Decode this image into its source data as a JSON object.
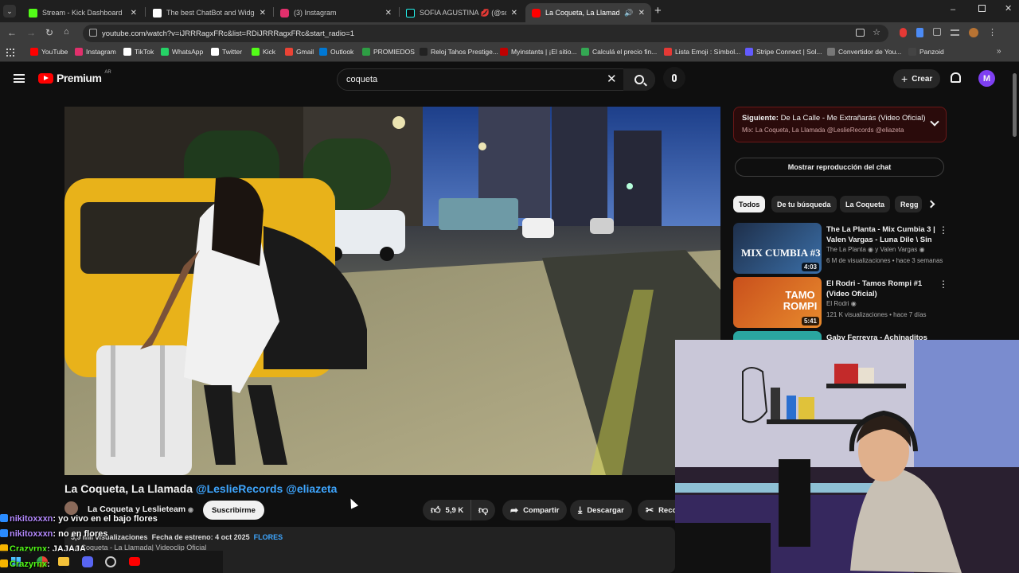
{
  "browser": {
    "tabs": [
      {
        "title": "Stream - Kick Dashboard",
        "color": "#53fc18"
      },
      {
        "title": "The best ChatBot and Widgets",
        "color": "#ffffff"
      },
      {
        "title": "(3) Instagram",
        "color": "#e1306c"
      },
      {
        "title": "SOFIA AGUSTINA 💋 (@sofiaag",
        "color": "#25f4ee"
      },
      {
        "title": "La Coqueta, La Llamada @L",
        "color": "#ff0000"
      }
    ],
    "new_tab": "+",
    "url": "youtube.com/watch?v=iJRRRagxFRc&list=RDiJRRRagxFRc&start_radio=1",
    "bookmarks": [
      {
        "label": "YouTube",
        "color": "#ff0000"
      },
      {
        "label": "Instagram",
        "color": "#e1306c"
      },
      {
        "label": "TikTok",
        "color": "#ffffff"
      },
      {
        "label": "WhatsApp",
        "color": "#25d366"
      },
      {
        "label": "Twitter",
        "color": "#ffffff"
      },
      {
        "label": "Kick",
        "color": "#53fc18"
      },
      {
        "label": "Gmail",
        "color": "#ea4335"
      },
      {
        "label": "Outlook",
        "color": "#0078d4"
      },
      {
        "label": "PROMIEDOS",
        "color": "#2e9e44"
      },
      {
        "label": "Reloj Tahos Prestige...",
        "color": "#222222"
      },
      {
        "label": "Myinstants | ¡El sitio...",
        "color": "#c00000"
      },
      {
        "label": "Calculá el precio fin...",
        "color": "#34a853"
      },
      {
        "label": "Lista Emoji : Símbol...",
        "color": "#e53935"
      },
      {
        "label": "Stripe Connect | Sol...",
        "color": "#635bff"
      },
      {
        "label": "Convertidor de You...",
        "color": "#777777"
      },
      {
        "label": "Panzoid",
        "color": "#444444"
      }
    ]
  },
  "youtube": {
    "logo_text": "Premium",
    "region": "AR",
    "search_value": "coqueta",
    "create_label": "Crear",
    "avatar_letter": "M",
    "video": {
      "title": "La Coqueta, La Llamada",
      "title_tags": "@LeslieRecords @eliazeta",
      "channel": "La Coqueta y Leslieteam",
      "subscribe": "Suscribirme",
      "likes": "5,9 K",
      "share": "Compartir",
      "download": "Descargar",
      "clip": "Reco",
      "views": "5,9 mil visualizaciones",
      "premiere": "Fecha de estreno: 4 oct 2025",
      "hashtag": "FLORES",
      "desc": "La Coqueta - La Llamada| Videoclip Oficial"
    },
    "up_next": {
      "prefix": "Siguiente:",
      "title": "De La Calle - Me Extrañarás (Video Oficial)",
      "subtitle": "Mix: La Coqueta, La Llamada @LeslieRecords @eliazeta"
    },
    "chat_replay": "Mostrar reproducción del chat",
    "chips": [
      "Todos",
      "De tu búsqueda",
      "La Coqueta",
      "Regg"
    ],
    "recommendations": [
      {
        "title": "The La Planta - Mix Cumbia 3 | Valen Vargas - Luna Dile \\ Sin ...",
        "channel": "The La Planta",
        "channel2": "y Valen Vargas",
        "meta": "6 M de visualizaciones • hace 3 semanas",
        "duration": "4:03",
        "thumb_text": "MIX CUMBIA #3"
      },
      {
        "title": "El Rodri - Tamos Rompi #1 (Video Oficial)",
        "channel": "El Rodri",
        "channel2": "",
        "meta": "121 K visualizaciones • hace 7 días",
        "duration": "5:41",
        "thumb_text": "TAMO ROMPI"
      },
      {
        "title": "Gaby Ferreyra - Achinaditos",
        "channel": "",
        "channel2": "",
        "meta": "",
        "duration": "",
        "thumb_text": ""
      }
    ]
  },
  "chat": [
    {
      "user": "nikitoxxxn",
      "msg": ": yo vivo en el bajo flores",
      "color": "#b58aff"
    },
    {
      "user": "nikitoxxxn",
      "msg": ": no en flores",
      "color": "#b58aff"
    },
    {
      "user": "Crazyrnx",
      "msg": ": JAJAJA",
      "color": "#53fc18"
    },
    {
      "user": "Crazyrnx",
      "msg": ":",
      "color": "#53fc18"
    }
  ]
}
